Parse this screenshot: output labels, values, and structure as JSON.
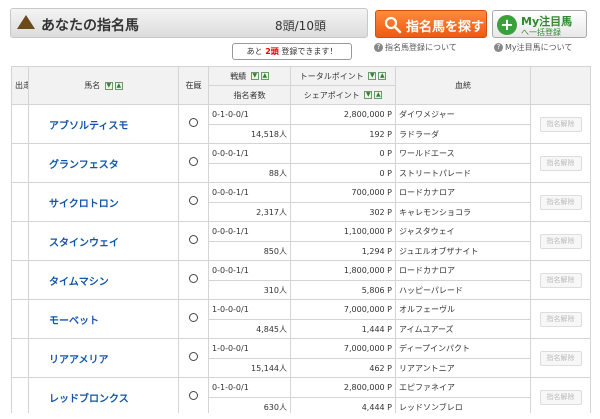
{
  "header": {
    "title": "あなたの指名馬",
    "count": "8頭/10頭"
  },
  "notice": {
    "prefix": "あと",
    "number": "2頭",
    "suffix": "登録できます！"
  },
  "buttons": {
    "search": "指名馬を探す",
    "my_line1": "My注目馬",
    "my_line2": "へ一括登録"
  },
  "help": {
    "search_help": "指名馬登録について",
    "my_help": "My注目馬について"
  },
  "columns": {
    "run": "出走",
    "name": "馬名",
    "stable": "在厩",
    "record": "戦績",
    "nominators": "指名者数",
    "total_points": "トータルポイント",
    "share_points": "シェアポイント",
    "pedigree": "血統"
  },
  "delete_label": "指名解除",
  "horses": [
    {
      "name": "アブソルティスモ",
      "record": "0-1-0-0/1",
      "nominators": "14,518人",
      "total": "2,800,000 P",
      "share": "192 P",
      "sire": "ダイワメジャー",
      "dam": "ラドラーダ"
    },
    {
      "name": "グランフェスタ",
      "record": "0-0-0-1/1",
      "nominators": "88人",
      "total": "0 P",
      "share": "0 P",
      "sire": "ワールドエース",
      "dam": "ストリートパレード"
    },
    {
      "name": "サイクロトロン",
      "record": "0-0-0-1/1",
      "nominators": "2,317人",
      "total": "700,000 P",
      "share": "302 P",
      "sire": "ロードカナロア",
      "dam": "キャレモンショコラ"
    },
    {
      "name": "スタインウェイ",
      "record": "0-0-0-1/1",
      "nominators": "850人",
      "total": "1,100,000 P",
      "share": "1,294 P",
      "sire": "ジャスタウェイ",
      "dam": "ジュエルオブザナイト"
    },
    {
      "name": "タイムマシン",
      "record": "0-0-0-1/1",
      "nominators": "310人",
      "total": "1,800,000 P",
      "share": "5,806 P",
      "sire": "ロードカナロア",
      "dam": "ハッピーパレード"
    },
    {
      "name": "モーベット",
      "record": "1-0-0-0/1",
      "nominators": "4,845人",
      "total": "7,000,000 P",
      "share": "1,444 P",
      "sire": "オルフェーヴル",
      "dam": "アイムユアーズ"
    },
    {
      "name": "リアアメリア",
      "record": "1-0-0-0/1",
      "nominators": "15,144人",
      "total": "7,000,000 P",
      "share": "462 P",
      "sire": "ディープインパクト",
      "dam": "リアアントニア"
    },
    {
      "name": "レッドブロンクス",
      "record": "0-1-0-0/1",
      "nominators": "630人",
      "total": "2,800,000 P",
      "share": "4,444 P",
      "sire": "エピファネイア",
      "dam": "レッドソンブレロ"
    }
  ],
  "colors": {
    "accent_orange": "#ef5a12",
    "link_blue": "#1155aa",
    "my_green": "#3aa13a"
  }
}
